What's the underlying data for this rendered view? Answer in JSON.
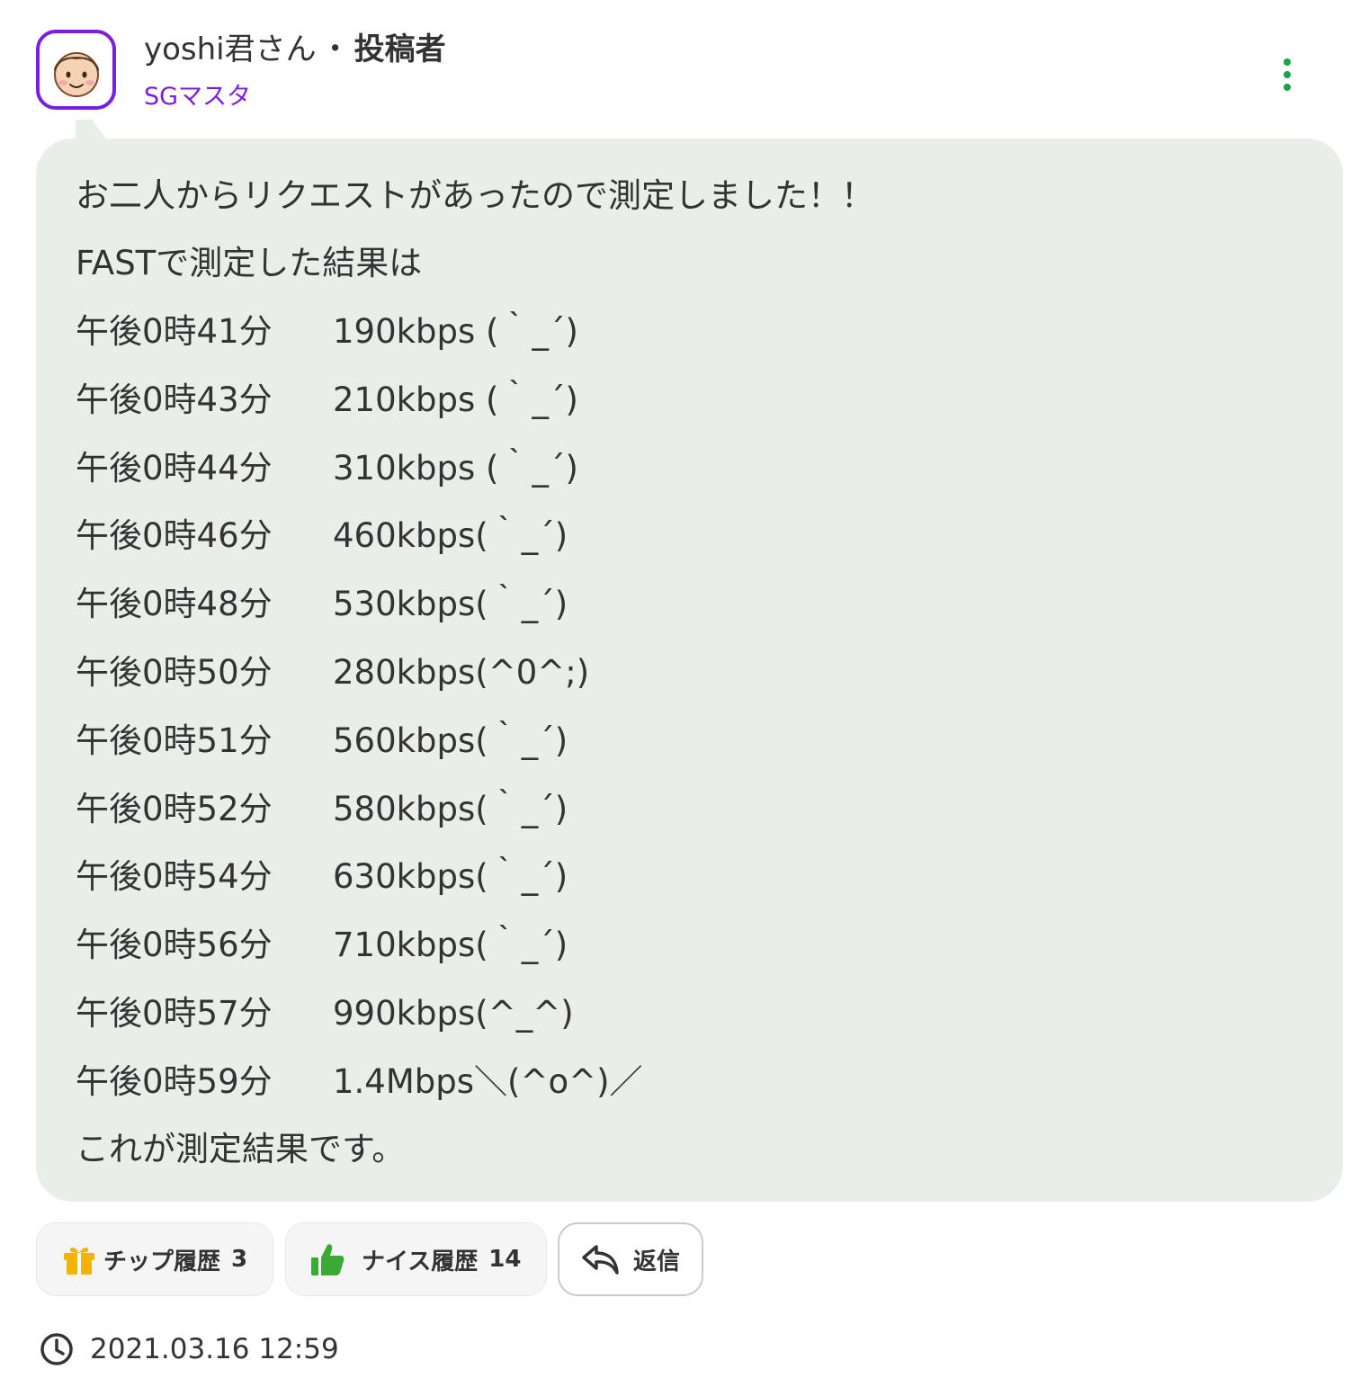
{
  "post": {
    "author_name": "yoshi君さん",
    "separator": "・",
    "author_role": "投稿者",
    "author_title": "SGマスタ",
    "intro_line": "お二人からリクエストがあったので測定しました！！",
    "measure_line": "FASTで測定した結果は",
    "measurements": [
      {
        "time": "午後0時41分",
        "speed": "190kbps (｀_´)"
      },
      {
        "time": "午後0時43分",
        "speed": "210kbps (｀_´)"
      },
      {
        "time": "午後0時44分",
        "speed": "310kbps (｀_´)"
      },
      {
        "time": "午後0時46分",
        "speed": "460kbps(｀_´)"
      },
      {
        "time": "午後0時48分",
        "speed": "530kbps(｀_´)"
      },
      {
        "time": "午後0時50分",
        "speed": "280kbps(^0^;)"
      },
      {
        "time": "午後0時51分",
        "speed": "560kbps(｀_´)"
      },
      {
        "time": "午後0時52分",
        "speed": "580kbps(｀_´)"
      },
      {
        "time": "午後0時54分",
        "speed": "630kbps(｀_´)"
      },
      {
        "time": "午後0時56分",
        "speed": "710kbps(｀_´)"
      },
      {
        "time": "午後0時57分",
        "speed": "990kbps(^_^)"
      },
      {
        "time": "午後0時59分",
        "speed": "1.4Mbps＼(^o^)／"
      }
    ],
    "closing_line": "これが測定結果です。",
    "timestamp": "2021.03.16 12:59"
  },
  "actions": {
    "tip_label": "チップ履歴",
    "tip_count": "3",
    "nice_label": "ナイス履歴",
    "nice_count": "14",
    "reply_label": "返信"
  },
  "colors": {
    "accent": "#7a1fe0",
    "bubble_bg": "#eaeeeb",
    "kebab": "#1aa34a",
    "tip_icon": "#f2b400",
    "nice_icon": "#3aaa35",
    "text": "#333333"
  },
  "icons": {
    "menu": "kebab-menu-icon",
    "tip": "gift-icon",
    "nice": "thumbs-up-icon",
    "reply": "reply-arrow-icon",
    "time": "clock-icon"
  }
}
